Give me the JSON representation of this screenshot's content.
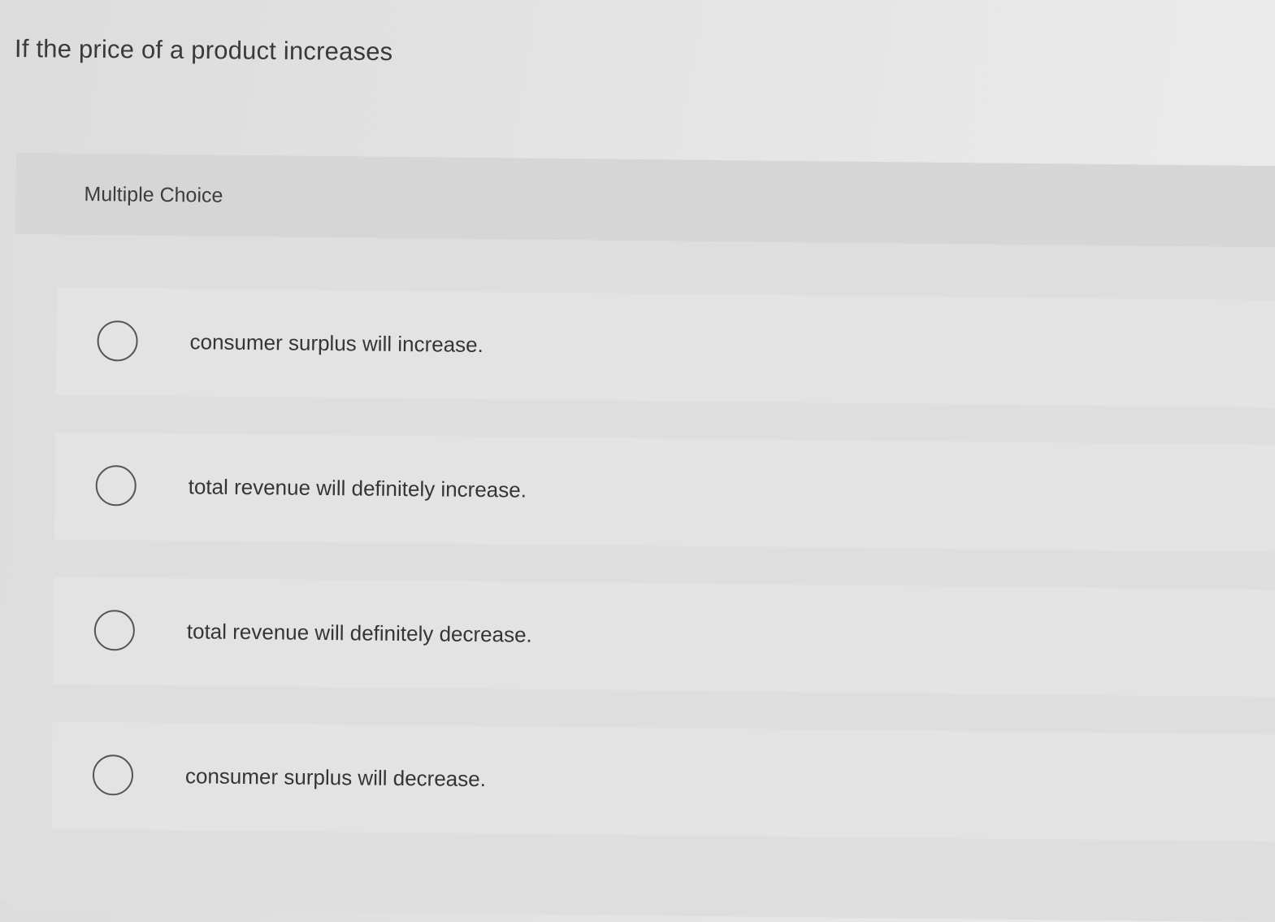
{
  "question": {
    "text": "If the price of a product increases"
  },
  "choices": {
    "type_label": "Multiple Choice",
    "options": [
      {
        "label": "consumer surplus will increase.",
        "selected": false
      },
      {
        "label": "total revenue will definitely increase.",
        "selected": false
      },
      {
        "label": "total revenue will definitely decrease.",
        "selected": false
      },
      {
        "label": "consumer surplus will decrease.",
        "selected": false
      }
    ]
  }
}
